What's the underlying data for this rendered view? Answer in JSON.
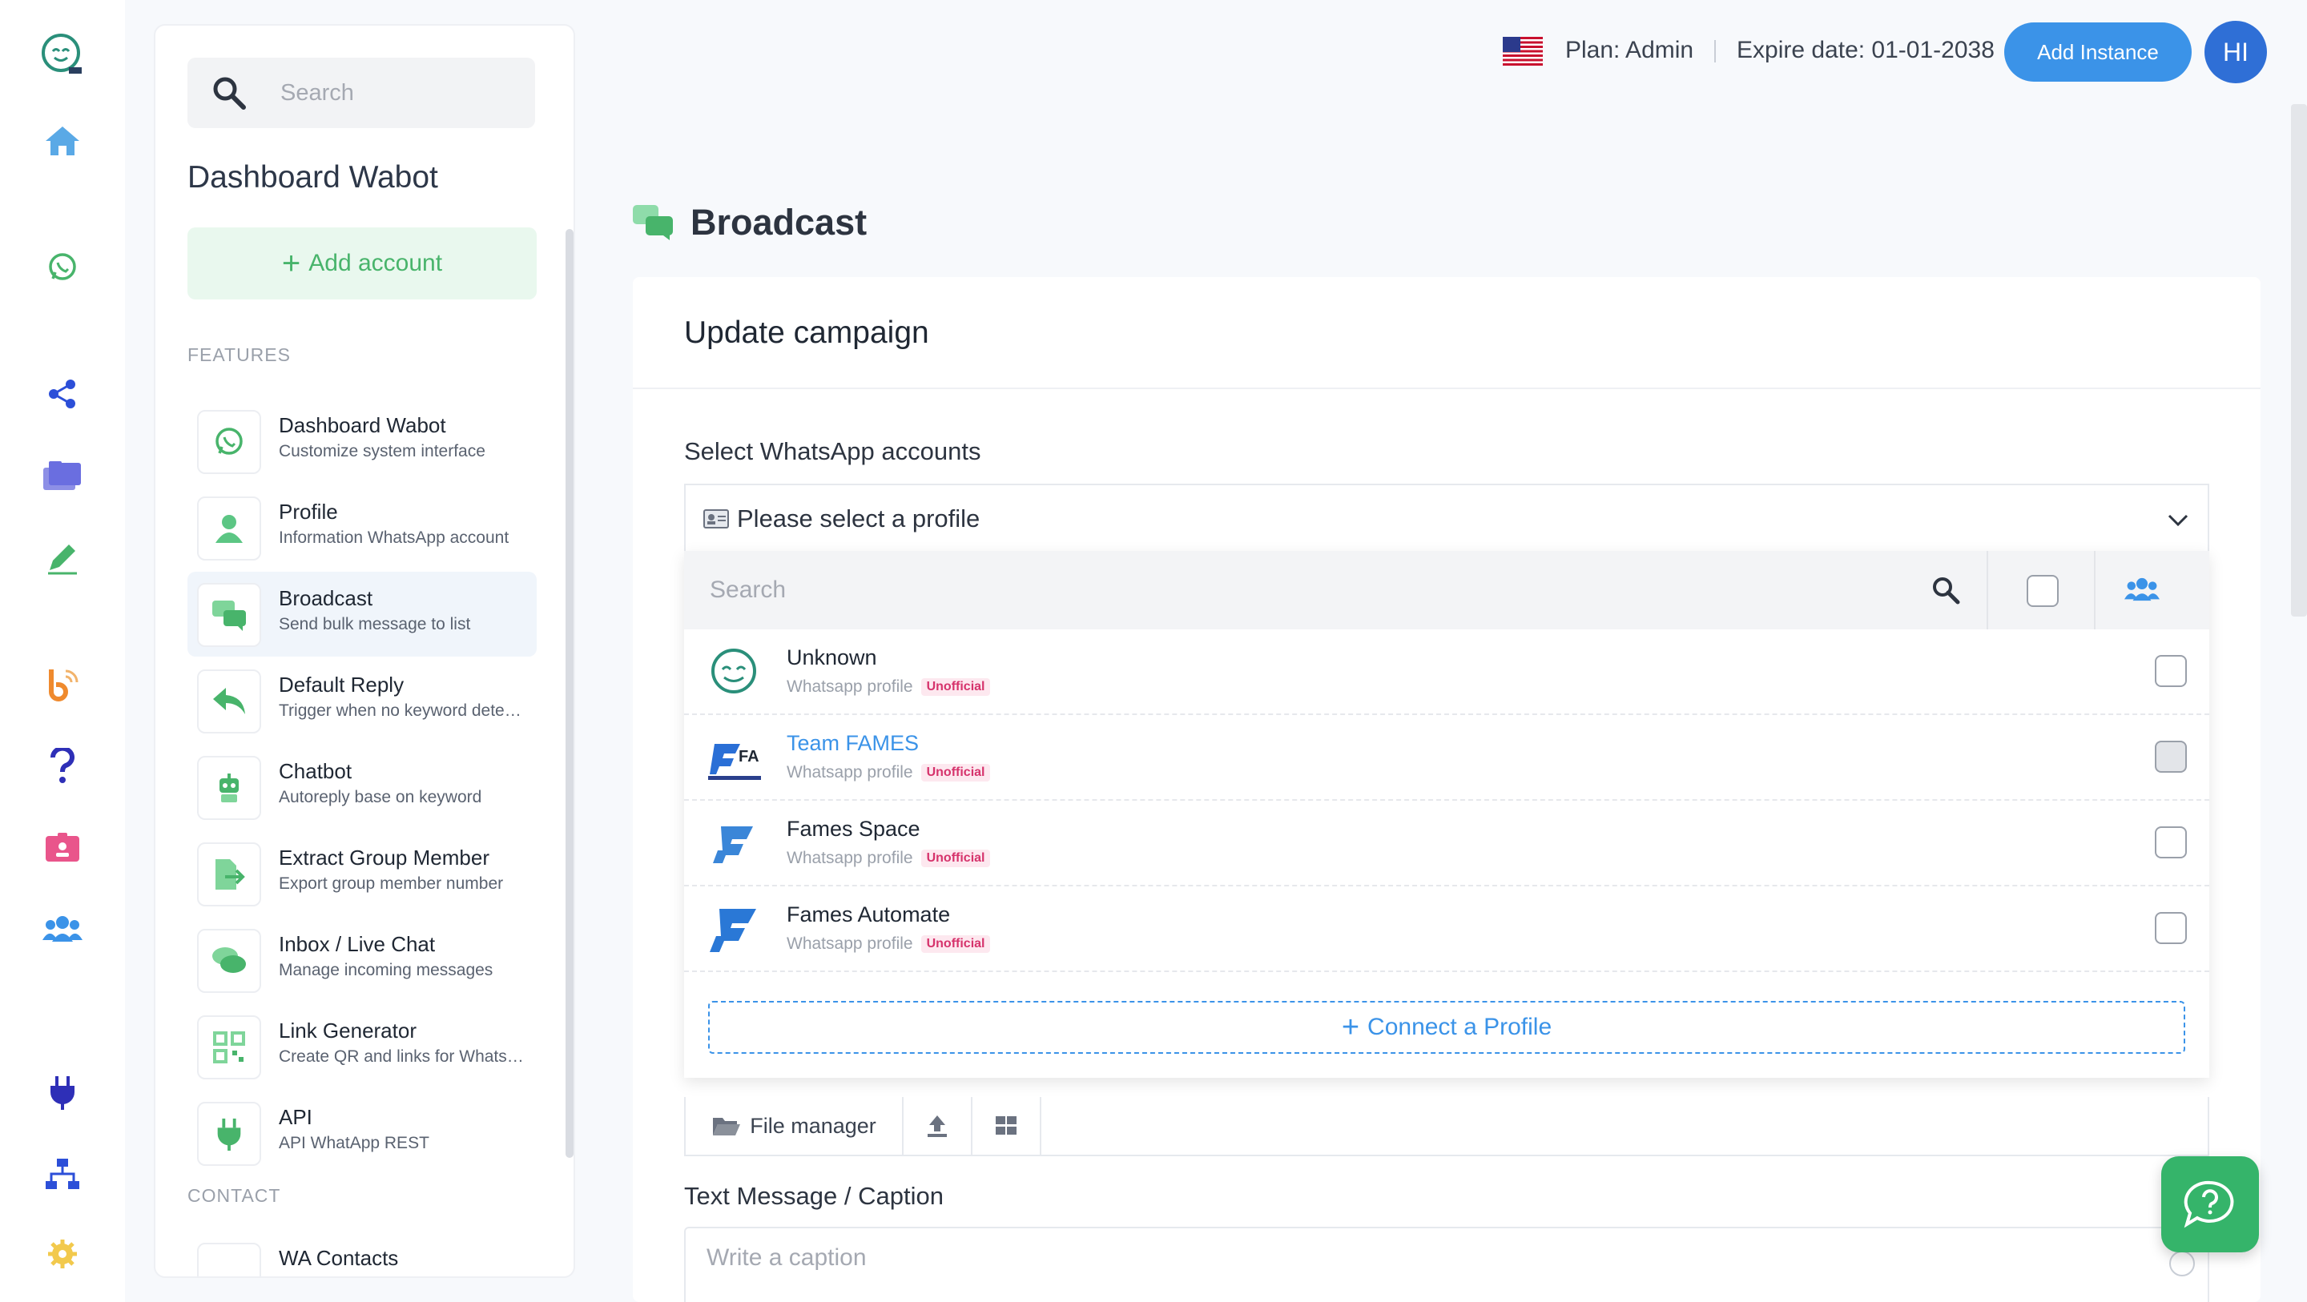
{
  "rail": {
    "icons": [
      "app-logo-icon",
      "home-icon",
      "whatsapp-icon",
      "share-icon",
      "folders-icon",
      "pencil-icon",
      "blog-icon",
      "help-question-icon",
      "id-badge-icon",
      "users-icon",
      "plug-icon",
      "sitemap-icon",
      "settings-gear-icon"
    ]
  },
  "sidebar": {
    "search_placeholder": "Search",
    "title": "Dashboard Wabot",
    "add_account": "Add account",
    "features_label": "FEATURES",
    "items": [
      {
        "title": "Dashboard Wabot",
        "subtitle": "Customize system interface",
        "icon": "whatsapp-icon"
      },
      {
        "title": "Profile",
        "subtitle": "Information WhatsApp account",
        "icon": "user-icon"
      },
      {
        "title": "Broadcast",
        "subtitle": "Send bulk message to list",
        "icon": "chat-bubbles-icon"
      },
      {
        "title": "Default Reply",
        "subtitle": "Trigger when no keyword detected",
        "icon": "reply-icon"
      },
      {
        "title": "Chatbot",
        "subtitle": "Autoreply base on keyword",
        "icon": "robot-icon"
      },
      {
        "title": "Extract Group Member",
        "subtitle": "Export group member number",
        "icon": "export-icon"
      },
      {
        "title": "Inbox / Live Chat",
        "subtitle": "Manage incoming messages",
        "icon": "inbox-chat-icon"
      },
      {
        "title": "Link Generator",
        "subtitle": "Create QR and links for WhatsApp",
        "icon": "qr-code-icon"
      },
      {
        "title": "API",
        "subtitle": "API WhatApp REST",
        "icon": "plug-icon"
      }
    ],
    "contact_label": "CONTACT",
    "contact_first": "WA Contacts"
  },
  "topbar": {
    "plan": "Plan: Admin",
    "expire": "Expire date: 01-01-2038",
    "add_instance": "Add Instance",
    "avatar": "HI"
  },
  "page": {
    "title": "Broadcast",
    "card_title": "Update campaign",
    "accounts_label": "Select WhatsApp accounts",
    "select_placeholder": "Please select a profile",
    "dropdown_search": "Search",
    "profiles": [
      {
        "name": "Unknown",
        "meta": "Whatsapp profile",
        "badge": "Unofficial"
      },
      {
        "name": "Team FAMES",
        "meta": "Whatsapp profile",
        "badge": "Unofficial"
      },
      {
        "name": "Fames Space",
        "meta": "Whatsapp profile",
        "badge": "Unofficial"
      },
      {
        "name": "Fames Automate",
        "meta": "Whatsapp profile",
        "badge": "Unofficial"
      }
    ],
    "connect_profile": "Connect a Profile",
    "file_manager": "File manager",
    "caption_label": "Text Message / Caption",
    "caption_placeholder": "Write a caption"
  },
  "colors": {
    "accent": "#3b93e8",
    "green": "#48b46b",
    "badge": "#d6336c"
  }
}
